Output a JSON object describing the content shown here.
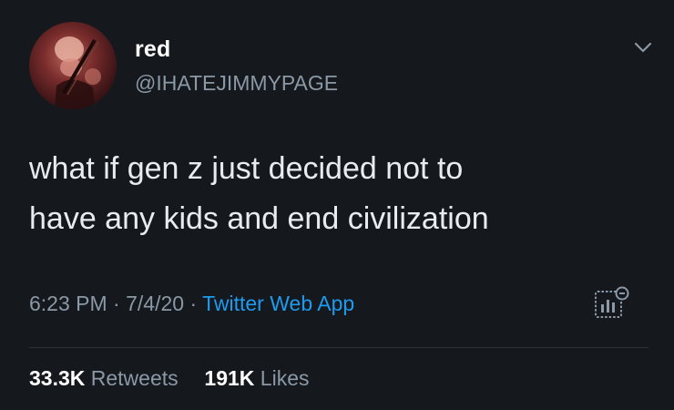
{
  "tweet": {
    "display_name": "red",
    "handle": "@IHATEJIMMYPAGE",
    "text_lines": [
      "what if gen z just decided not to",
      "have any kids and end civilization"
    ],
    "time": "6:23 PM",
    "separator": "·",
    "date": "7/4/20",
    "source": "Twitter Web App",
    "retweets_count": "33.3K",
    "retweets_label": "Retweets",
    "likes_count": "191K",
    "likes_label": "Likes"
  },
  "icons": {
    "menu": "chevron-down-icon",
    "analytics": "tweet-analytics-icon",
    "avatar": "profile-photo"
  },
  "colors": {
    "background": "#15181c",
    "primary_text": "#ffffff",
    "secondary_text": "#8b98a5",
    "link": "#1d9bf0",
    "divider": "#2f3336"
  }
}
